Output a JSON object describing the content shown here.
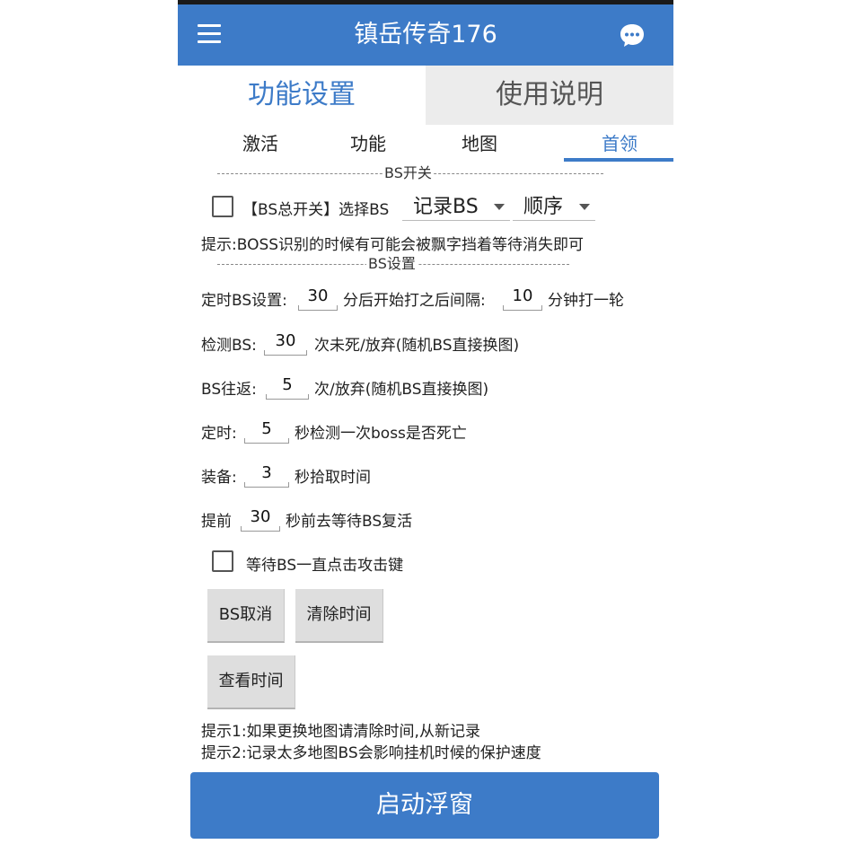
{
  "header": {
    "title": "镇岳传奇176",
    "brand_color": "#3d7bc8",
    "menu_icon": "menu-icon",
    "chat_icon": "chat-bubble-icon"
  },
  "top_tabs": [
    {
      "label": "功能设置",
      "active": true
    },
    {
      "label": "使用说明",
      "active": false
    }
  ],
  "sub_tabs": [
    {
      "label": "激活",
      "active": false
    },
    {
      "label": "功能",
      "active": false
    },
    {
      "label": "地图",
      "active": false
    },
    {
      "label": "首领",
      "active": true
    }
  ],
  "bs_switch_section": {
    "title": "BS开关",
    "master_switch_label": "【BS总开关】选择BS",
    "master_switch_checked": false,
    "mode_select": "记录BS",
    "order_select": "顺序",
    "hint": "提示:BOSS识别的时候有可能会被飘字挡着等待消失即可"
  },
  "bs_settings_section": {
    "title": "BS设置",
    "timed": {
      "label": "定时BS设置:",
      "start_value": "30",
      "mid_text": "分后开始打之后间隔:",
      "interval_value": "10",
      "suffix": "分钟打一轮"
    },
    "detect": {
      "label": "检测BS:",
      "value": "30",
      "suffix": "次未死/放弃(随机BS直接换图)"
    },
    "roundtrip": {
      "label": "BS往返:",
      "value": "5",
      "suffix": "次/放弃(随机BS直接换图)"
    },
    "check_timer": {
      "label": "定时:",
      "value": "5",
      "suffix": "秒检测一次boss是否死亡"
    },
    "equip": {
      "label": "装备:",
      "value": "3",
      "suffix": "秒拾取时间"
    },
    "advance": {
      "label": "提前",
      "value": "30",
      "suffix": "秒前去等待BS复活"
    },
    "wait_attack": {
      "label": "等待BS一直点击攻击键",
      "checked": false
    }
  },
  "buttons": {
    "cancel_bs": "BS取消",
    "clear_time": "清除时间",
    "view_time": "查看时间"
  },
  "hints": {
    "hint1": "提示1:如果更换地图请清除时间,从新记录",
    "hint2": "提示2:记录太多地图BS会影响挂机时候的保护速度"
  },
  "float_button": "启动浮窗"
}
